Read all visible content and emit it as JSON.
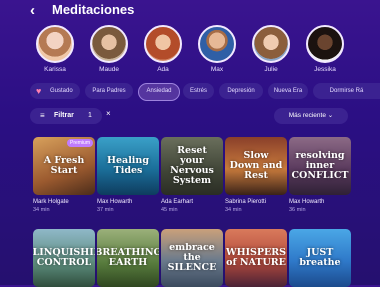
{
  "header": {
    "back_icon": "‹",
    "title": "Meditaciones"
  },
  "avatars": [
    {
      "name": "Karissa"
    },
    {
      "name": "Maude"
    },
    {
      "name": "Ada"
    },
    {
      "name": "Max"
    },
    {
      "name": "Julie"
    },
    {
      "name": "Jessika"
    }
  ],
  "tags": [
    "Gustado",
    "Para Padres",
    "Ansiedad",
    "Estrés",
    "Depresión",
    "Nueva Era",
    "Dormirse Rá"
  ],
  "filter": {
    "label": "Filtrar",
    "count": "1",
    "clear_icon": "×"
  },
  "sort": {
    "label": "Más reciente",
    "icon": "⌄"
  },
  "cards": [
    {
      "title": "A Fresh Start",
      "author": "Mark Holgate",
      "duration": "34 min",
      "badge": "Premium"
    },
    {
      "title": "Healing Tides",
      "author": "Max Howarth",
      "duration": "37 min",
      "badge": ""
    },
    {
      "title": "Reset your Nervous System",
      "author": "Ada Earhart",
      "duration": "45 min",
      "badge": ""
    },
    {
      "title": "Slow Down and Rest",
      "author": "Sabrina Pierotti",
      "duration": "34 min",
      "badge": ""
    },
    {
      "title": "resolving inner CONFLICT",
      "author": "Max Howarth",
      "duration": "36 min",
      "badge": ""
    },
    {
      "title": "RELINQUISHING CONTROL",
      "author": "",
      "duration": "",
      "badge": ""
    },
    {
      "title": "BREATHING EARTH",
      "author": "",
      "duration": "",
      "badge": ""
    },
    {
      "title": "embrace the SILENCE",
      "author": "",
      "duration": "",
      "badge": ""
    },
    {
      "title": "WHISPERS of NATURE",
      "author": "",
      "duration": "",
      "badge": ""
    },
    {
      "title": "JUST breathe",
      "author": "",
      "duration": "",
      "badge": ""
    }
  ]
}
